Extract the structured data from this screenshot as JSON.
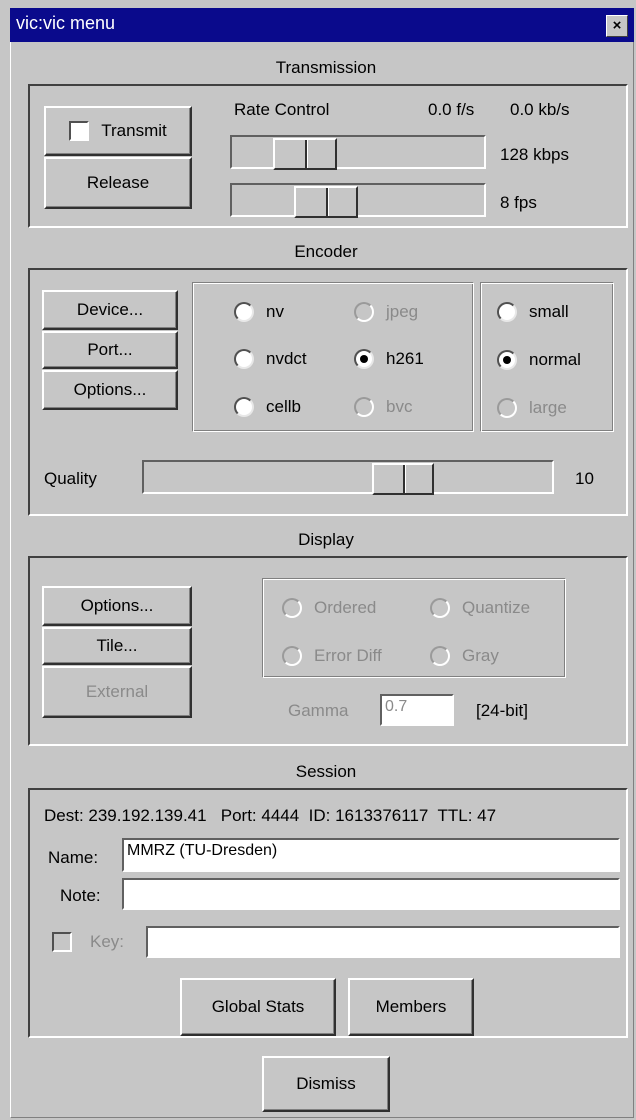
{
  "window": {
    "title": "vic:vic menu",
    "close_glyph": "×"
  },
  "transmission": {
    "title": "Transmission",
    "transmit_label": "Transmit",
    "transmit_checked": false,
    "release_label": "Release",
    "rate_control_label": "Rate Control",
    "frame_rate": "0.0 f/s",
    "bit_rate": "0.0 kb/s",
    "bandwidth_label": "128 kbps",
    "bandwidth_level": 0.22,
    "fps_label": "8 fps",
    "fps_level": 0.33
  },
  "encoder": {
    "title": "Encoder",
    "device_button": "Device...",
    "port_button": "Port...",
    "options_button": "Options...",
    "formats": [
      {
        "label": "nv",
        "selected": false,
        "enabled": true
      },
      {
        "label": "jpeg",
        "selected": false,
        "enabled": false
      },
      {
        "label": "nvdct",
        "selected": false,
        "enabled": true
      },
      {
        "label": "h261",
        "selected": true,
        "enabled": true
      },
      {
        "label": "cellb",
        "selected": false,
        "enabled": true
      },
      {
        "label": "bvc",
        "selected": false,
        "enabled": false
      }
    ],
    "sizes": [
      {
        "label": "small",
        "selected": false,
        "enabled": true
      },
      {
        "label": "normal",
        "selected": true,
        "enabled": true
      },
      {
        "label": "large",
        "selected": false,
        "enabled": false
      }
    ],
    "quality_label": "Quality",
    "quality_value": "10",
    "quality_level": 0.66
  },
  "display": {
    "title": "Display",
    "options_button": "Options...",
    "tile_button": "Tile...",
    "external_button": "External",
    "dither_options": [
      {
        "label": "Ordered",
        "enabled": false
      },
      {
        "label": "Quantize",
        "enabled": false
      },
      {
        "label": "Error Diff",
        "enabled": false
      },
      {
        "label": "Gray",
        "enabled": false
      }
    ],
    "gamma_label": "Gamma",
    "gamma_value": "0.7",
    "depth_label": "[24-bit]"
  },
  "session": {
    "title": "Session",
    "info_line": "Dest: 239.192.139.41   Port: 4444  ID: 1613376117  TTL: 47",
    "name_label": "Name:",
    "name_value": "MMRZ (TU-Dresden)",
    "note_label": "Note:",
    "note_value": "",
    "key_label": "Key:",
    "key_value": "",
    "key_checked": false,
    "global_stats_button": "Global Stats",
    "members_button": "Members"
  },
  "dismiss_button": "Dismiss"
}
